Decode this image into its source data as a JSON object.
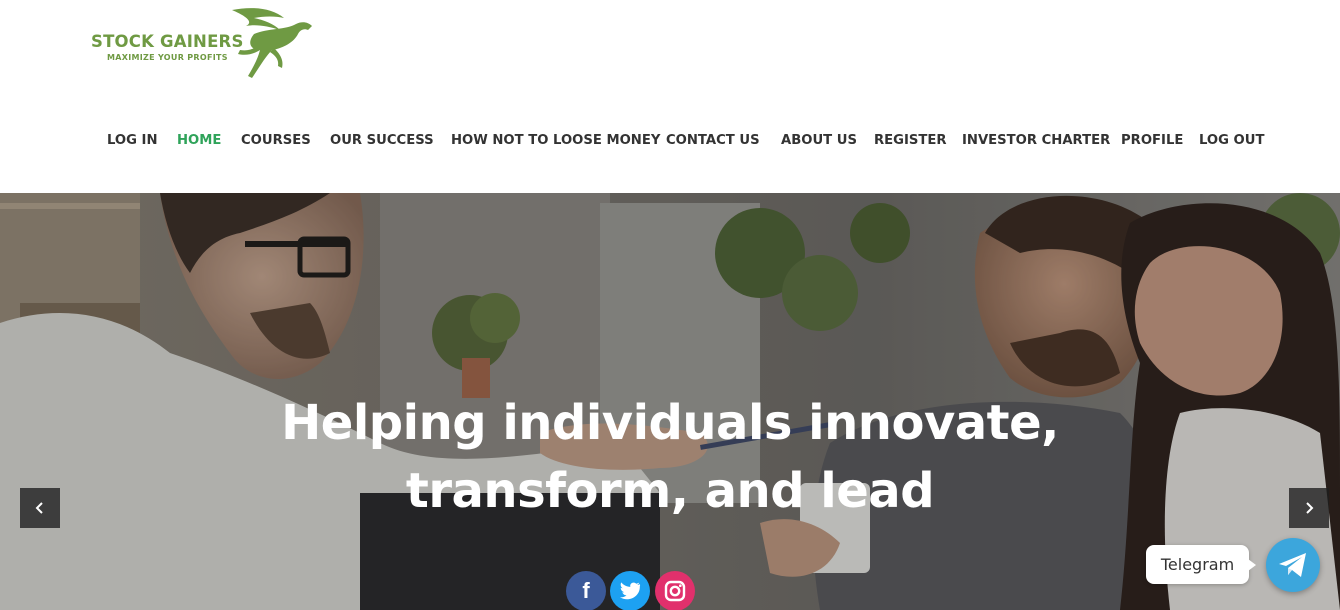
{
  "brand": {
    "name": "STOCK GAINERS",
    "tagline": "MAXIMIZE YOUR PROFITS",
    "color": "#6f9a43",
    "icon": "pegasus-icon"
  },
  "nav": {
    "items": [
      {
        "label": "LOG IN"
      },
      {
        "label": "HOME",
        "active": true
      },
      {
        "label": "COURSES"
      },
      {
        "label": "OUR SUCCESS"
      },
      {
        "label": "HOW NOT TO LOOSE MONEY"
      },
      {
        "label": "CONTACT US"
      },
      {
        "label": "ABOUT US"
      },
      {
        "label": "REGISTER"
      },
      {
        "label": "INVESTOR CHARTER"
      },
      {
        "label": "PROFILE"
      },
      {
        "label": "LOG OUT"
      }
    ],
    "active_color": "#2fa35a"
  },
  "hero": {
    "title_line1": "Helping individuals innovate,",
    "title_line2": "transform, and lead",
    "prev_icon": "chevron-left-icon",
    "next_icon": "chevron-right-icon"
  },
  "social": {
    "facebook_icon": "facebook-icon",
    "twitter_icon": "twitter-icon",
    "instagram_icon": "instagram-icon"
  },
  "telegram": {
    "label": "Telegram",
    "icon": "telegram-icon",
    "color": "#3ca6dc"
  }
}
